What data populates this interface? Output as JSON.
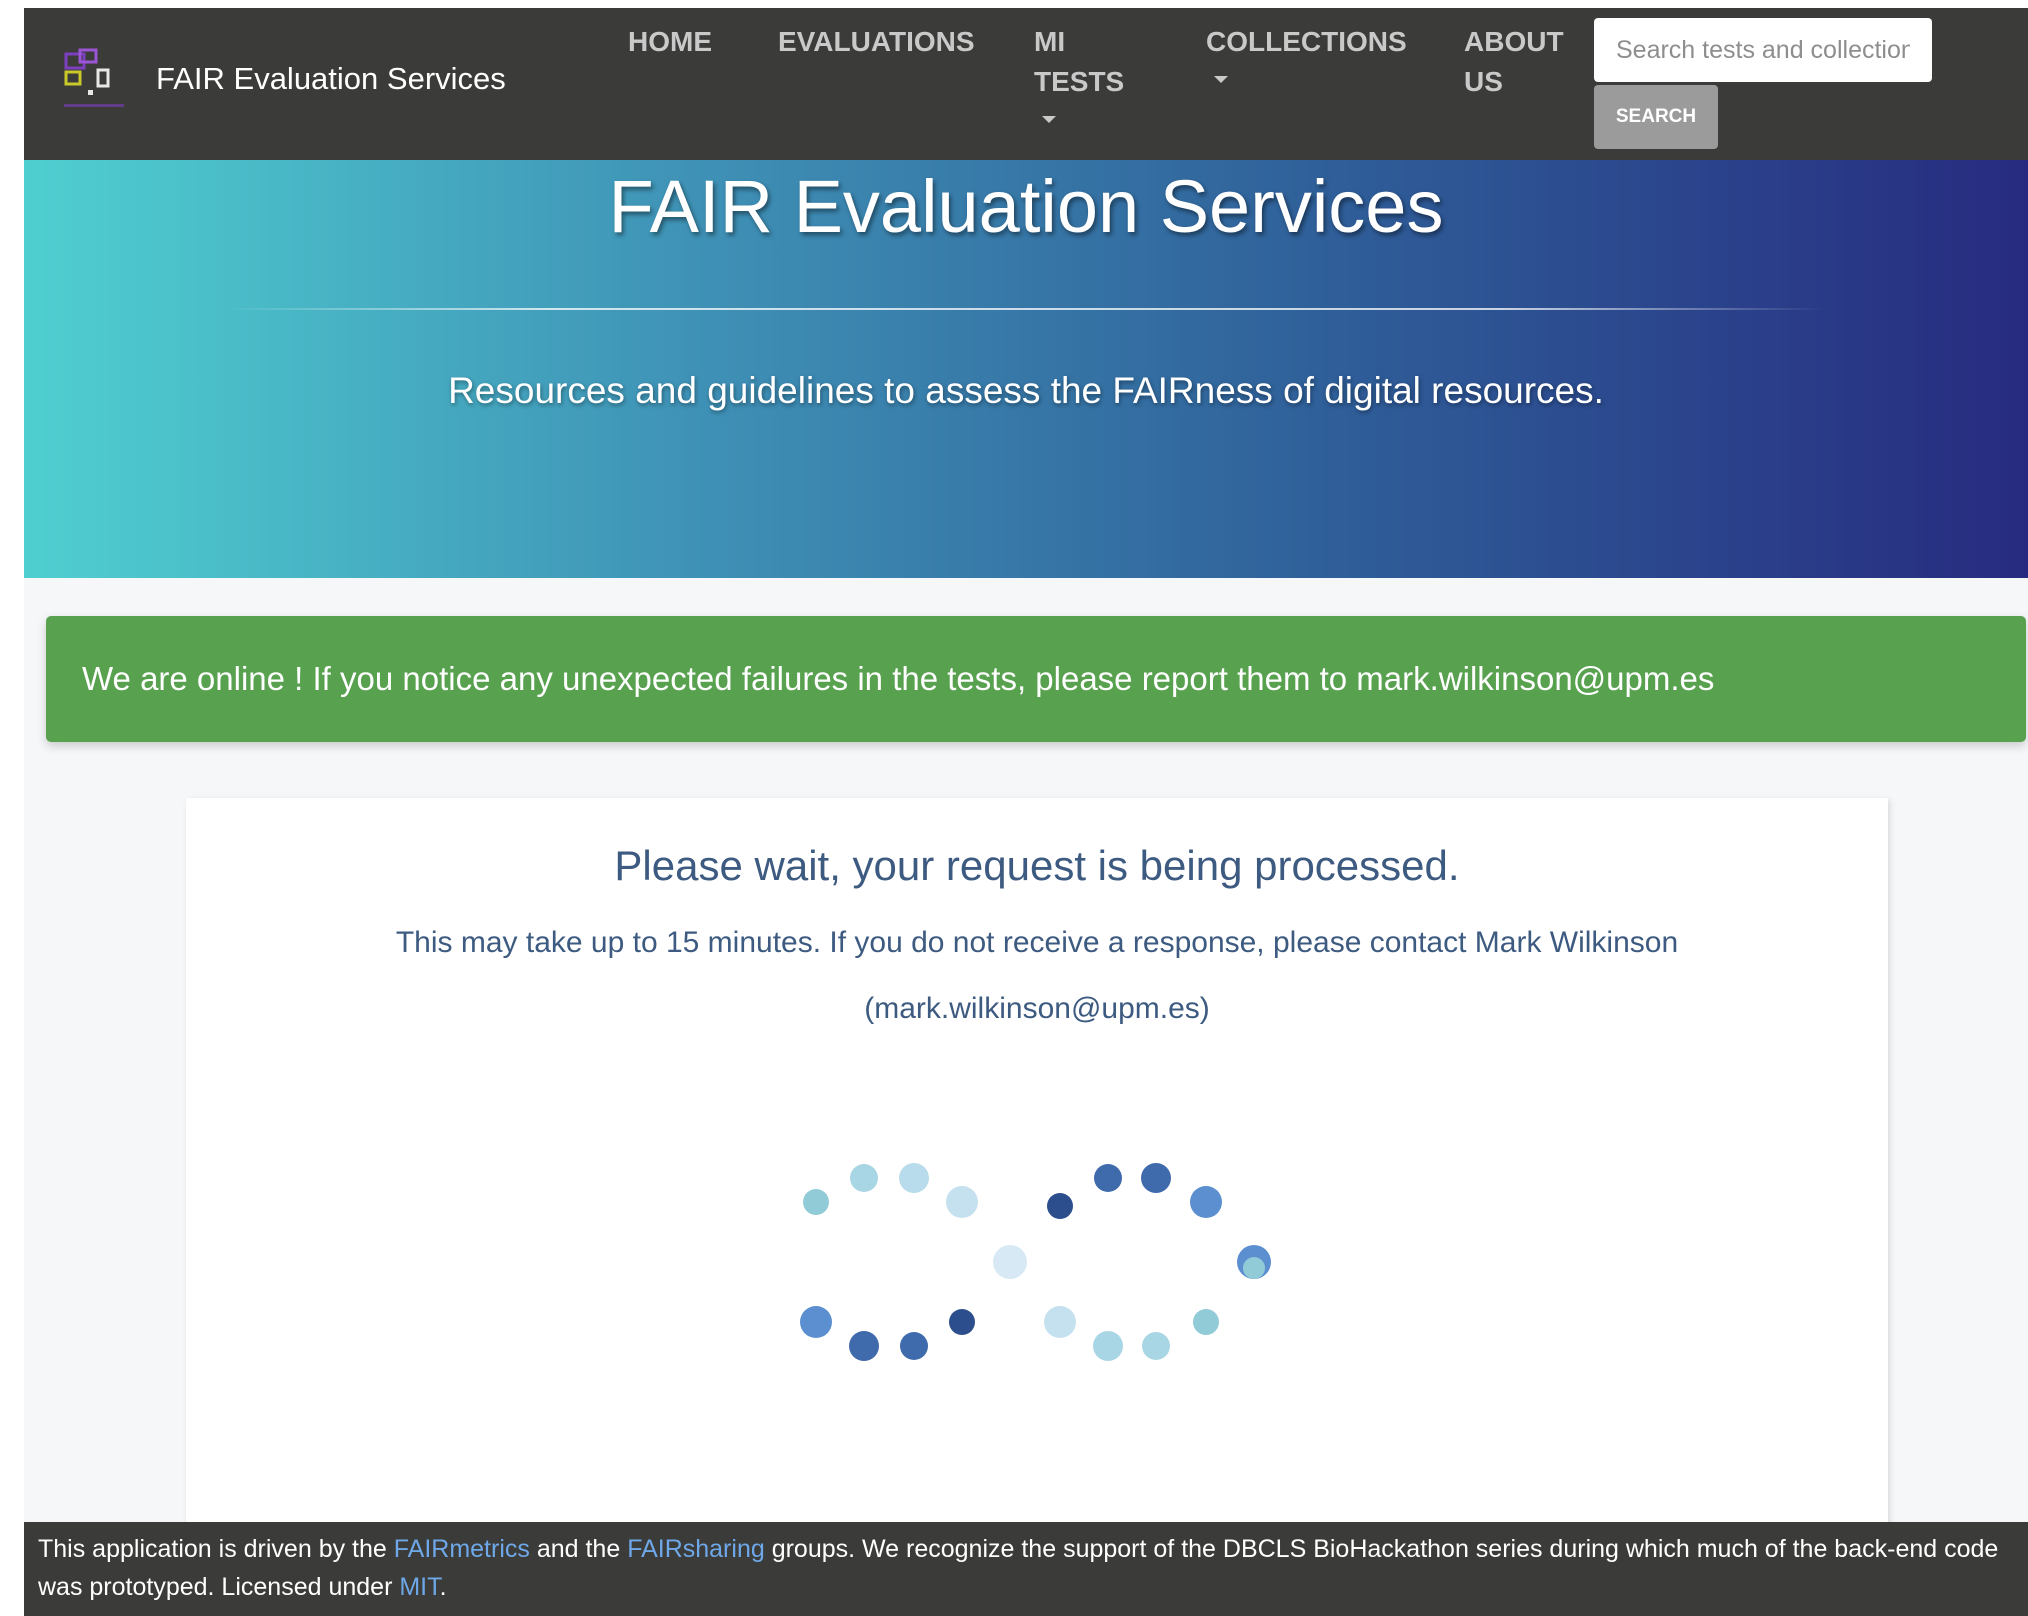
{
  "navbar": {
    "brand_title": "FAIR Evaluation Services",
    "items": [
      {
        "label": "HOME",
        "dropdown": false
      },
      {
        "label": "EVALUATIONS",
        "dropdown": false
      },
      {
        "label": "MI TESTS",
        "line1": "MI",
        "line2": "TESTS",
        "dropdown": true
      },
      {
        "label": "COLLECTIONS",
        "dropdown": true
      },
      {
        "label": "ABOUT US",
        "line1": "ABOUT",
        "line2": "US",
        "dropdown": false
      }
    ],
    "search": {
      "placeholder": "Search tests and collections",
      "button_label": "SEARCH"
    }
  },
  "hero": {
    "title": "FAIR Evaluation Services",
    "subtitle": "Resources and guidelines to assess the FAIRness of digital resources."
  },
  "alert": {
    "text": "We are online ! If you notice any unexpected failures in the tests, please report them to mark.wilkinson@upm.es"
  },
  "processing": {
    "heading": "Please wait, your request is being processed.",
    "line1": "This may take up to 15 minutes. If you do not receive a response, please contact Mark Wilkinson",
    "line2": "(mark.wilkinson@upm.es)"
  },
  "footer": {
    "text_1": "This application is driven by the ",
    "link_1": "FAIRmetrics",
    "text_2": " and the ",
    "link_2": "FAIRsharing",
    "text_3": " groups. We recognize the support of the DBCLS BioHackathon series during which much of the back-end code was prototyped. Licensed under ",
    "link_3": "MIT",
    "text_4": "."
  },
  "colors": {
    "navbar": "#3b3b39",
    "alert_green": "#58a14f",
    "link_blue": "#6ea8e8",
    "heading_blue": "#3d5a80",
    "spinner_palette": [
      "#91cbd8",
      "#a9d6e5",
      "#c5e1ef",
      "#5b8fd0",
      "#3f6bac",
      "#2d4e8c"
    ]
  },
  "icons": {
    "logo": "fair-metrics-logo",
    "spinner": "loading-spinner-icon"
  }
}
